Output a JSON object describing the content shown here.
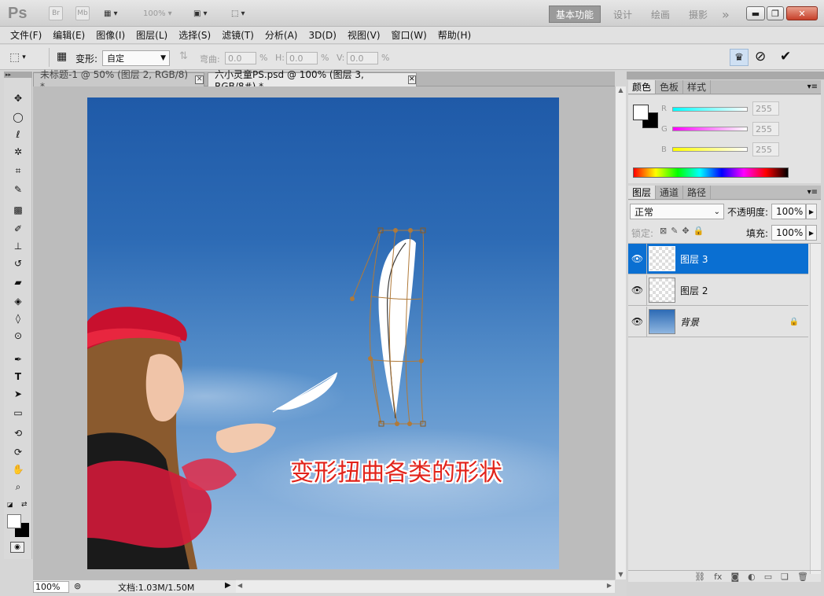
{
  "app": {
    "logo": "Ps",
    "bridge_label": "Br",
    "minibridge_label": "Mb",
    "zoom_label": "100%",
    "workspaces": [
      "基本功能",
      "设计",
      "绘画",
      "摄影"
    ],
    "more_label": "»"
  },
  "menu": [
    "文件(F)",
    "编辑(E)",
    "图像(I)",
    "图层(L)",
    "选择(S)",
    "滤镜(T)",
    "分析(A)",
    "3D(D)",
    "视图(V)",
    "窗口(W)",
    "帮助(H)"
  ],
  "options": {
    "transform_label": "变形:",
    "preset_value": "自定",
    "bend_label": "弯曲:",
    "bend_value": "0.0",
    "h_label": "H:",
    "h_value": "0.0",
    "v_label": "V:",
    "v_value": "0.0",
    "pct": "%"
  },
  "tabs": [
    {
      "label": "未标题-1 @ 50% (图层 2, RGB/8) *",
      "close": "✕"
    },
    {
      "label": "六小灵童PS.psd @ 100% (图层 3, RGB/8#) *",
      "close": "✕"
    }
  ],
  "canvas": {
    "caption": "变形扭曲各类的形状"
  },
  "status": {
    "zoom": "100%",
    "doc_info": "文档:1.03M/1.50M"
  },
  "color_panel": {
    "tabs": [
      "颜色",
      "色板",
      "样式"
    ],
    "channels": [
      {
        "label": "R",
        "value": "255",
        "color": "#3fd6d6"
      },
      {
        "label": "G",
        "value": "255",
        "color": "#e23fe2"
      },
      {
        "label": "B",
        "value": "255",
        "color": "#eaea2a"
      }
    ]
  },
  "layers_panel": {
    "tabs": [
      "图层",
      "通道",
      "路径"
    ],
    "blend_mode": "正常",
    "opacity_label": "不透明度:",
    "opacity_value": "100%",
    "lock_label": "锁定:",
    "fill_label": "填充:",
    "fill_value": "100%",
    "layers": [
      {
        "name": "图层 3",
        "selected": true
      },
      {
        "name": "图层 2",
        "selected": false
      },
      {
        "name": "背景",
        "selected": false
      }
    ]
  },
  "colors": {
    "accent": "#0a6fd2",
    "caption": "#e2231a",
    "warp_line": "#b07a3a"
  }
}
